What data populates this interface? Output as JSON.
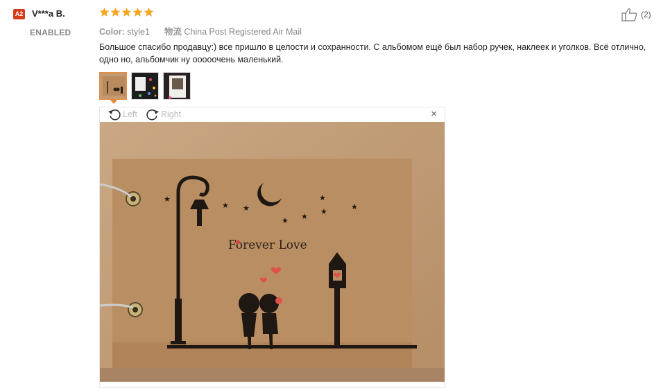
{
  "reviewer": {
    "country_code": "A2",
    "name": "V***a B.",
    "status": "ENABLED"
  },
  "rating": {
    "stars": 5,
    "max": 5,
    "star_color": "#f5a623"
  },
  "meta": {
    "color_label": "Color:",
    "color_value": "style1",
    "shipping_label": "物流",
    "shipping_value": "China Post Registered Air Mail"
  },
  "review_text": "Большое спасибо продавцу:) все пришло в целости и сохранности. С альбомом ещё был набор ручек, наклеек и уголков. Всё отлично, одно но, альбомчик ну ооооочень маленький.",
  "helpful": {
    "icon": "thumbs-up-icon",
    "count": "(2)"
  },
  "viewer": {
    "rotate_left_label": "Left",
    "rotate_right_label": "Right",
    "close_label": "×",
    "cover_text": "Forever Love"
  },
  "colors": {
    "accent": "#e8883a",
    "badge": "#d73c1a",
    "kraft": "#b98e63"
  }
}
